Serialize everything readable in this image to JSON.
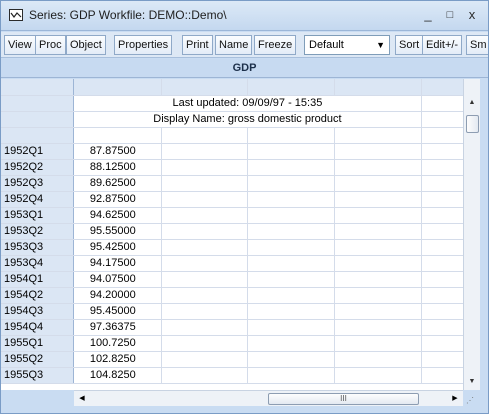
{
  "window": {
    "title": "Series: GDP   Workfile: DEMO::Demo\\",
    "minimize": "_",
    "maximize": "□",
    "close": "x"
  },
  "toolbar": {
    "buttons": [
      "View",
      "Proc",
      "Object",
      "Properties",
      "Print",
      "Name",
      "Freeze",
      "Sort",
      "Edit+/-",
      "Sm"
    ],
    "select_value": "Default"
  },
  "series": {
    "name": "GDP",
    "last_updated": "Last updated: 09/09/97 - 15:35",
    "display_name": "Display Name: gross domestic product"
  },
  "rows": [
    {
      "obs": "1952Q1",
      "value": "87.87500"
    },
    {
      "obs": "1952Q2",
      "value": "88.12500"
    },
    {
      "obs": "1952Q3",
      "value": "89.62500"
    },
    {
      "obs": "1952Q4",
      "value": "92.87500"
    },
    {
      "obs": "1953Q1",
      "value": "94.62500"
    },
    {
      "obs": "1953Q2",
      "value": "95.55000"
    },
    {
      "obs": "1953Q3",
      "value": "95.42500"
    },
    {
      "obs": "1953Q4",
      "value": "94.17500"
    },
    {
      "obs": "1954Q1",
      "value": "94.07500"
    },
    {
      "obs": "1954Q2",
      "value": "94.20000"
    },
    {
      "obs": "1954Q3",
      "value": "95.45000"
    },
    {
      "obs": "1954Q4",
      "value": "97.36375"
    },
    {
      "obs": "1955Q1",
      "value": "100.7250"
    },
    {
      "obs": "1955Q2",
      "value": "102.8250"
    },
    {
      "obs": "1955Q3",
      "value": "104.8250"
    }
  ],
  "colors": {
    "titlebar": "#c4d8ef",
    "obs_column": "#dbe6f4",
    "header": "#c7daf1"
  }
}
